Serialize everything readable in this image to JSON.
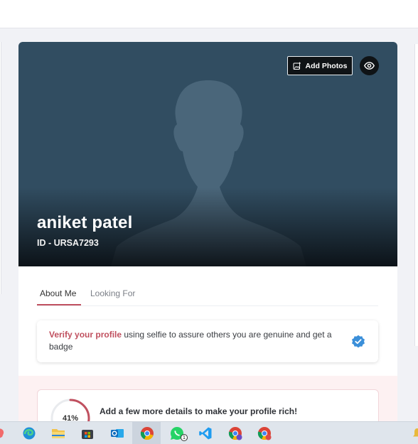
{
  "hero": {
    "add_photos_label": "Add Photos",
    "name": "aniket patel",
    "id_text": "ID - URSA7293"
  },
  "tabs": [
    {
      "label": "About Me",
      "active": true
    },
    {
      "label": "Looking For",
      "active": false
    }
  ],
  "verify": {
    "link_text": "Verify your profile",
    "rest_text": " using selfie to assure others you are genuine and get a badge"
  },
  "profile_completion": {
    "percent_label": "41%",
    "percent": 41,
    "message": "Add a few more details to make your profile rich!"
  },
  "taskbar": {
    "icons": [
      "copilot-icon",
      "edge-icon",
      "file-explorer-icon",
      "store-icon",
      "outlook-icon",
      "chrome-icon",
      "whatsapp-icon",
      "vscode-icon",
      "chrome-profile-icon",
      "chrome-profile-2-icon"
    ],
    "whatsapp_badge": "1"
  },
  "colors": {
    "accent": "#c0505f",
    "hero_bg": "#314d61",
    "verified": "#3b8fd9"
  }
}
